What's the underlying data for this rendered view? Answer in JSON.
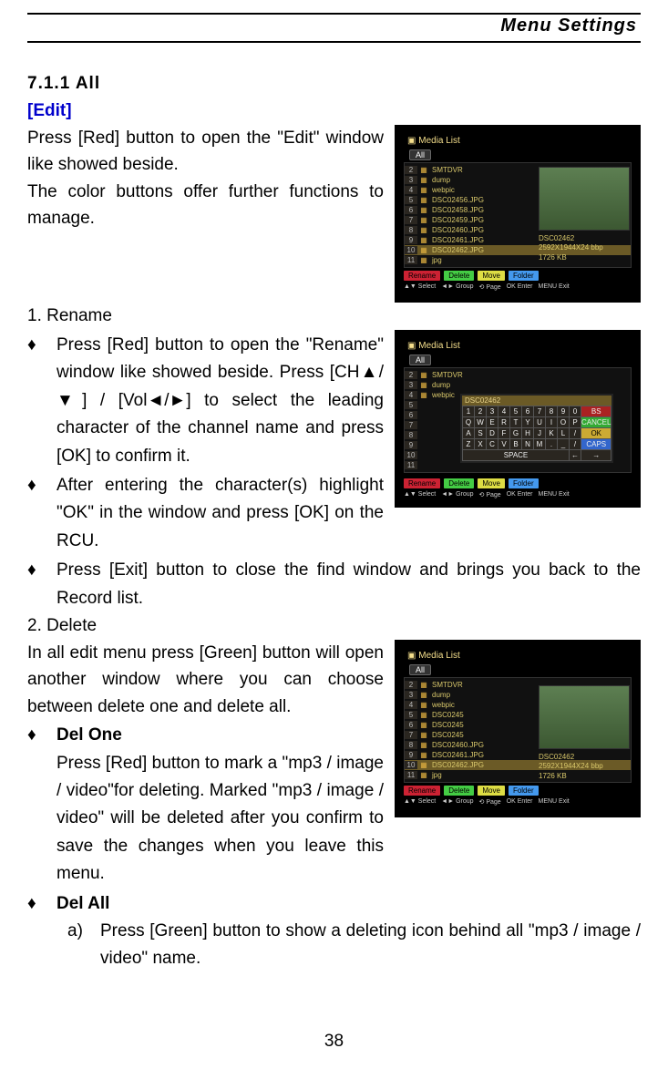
{
  "header": {
    "section": "Menu Settings"
  },
  "title": "7.1.1  All",
  "edit_label": "[Edit]",
  "intro1": "Press [Red] button to open the \"Edit\" window like showed beside.",
  "intro2": "The color buttons offer further functions to manage.",
  "h_rename": "1.   Rename",
  "rename_b1": "Press [Red] button to open the \"Rename\" window like showed beside. Press [CH▲/▼] / [Vol◄/►] to select the leading character of the channel name and press [OK] to confirm it.",
  "rename_b2": "After entering the character(s) highlight \"OK\" in the window and press [OK] on the RCU.",
  "rename_b3": "Press [Exit] button to close the find window and brings you back to the Record list.",
  "h_delete": "2.   Delete",
  "delete_intro": "In all edit menu press [Green] button will open another window where you can choose between delete one and delete all.",
  "delone_h": "Del One",
  "delone_p": "Press [Red] button to mark a \"mp3 / image / video\"for deleting. Marked \"mp3 / image / video\" will be deleted after you confirm to save the changes when you leave this menu.",
  "delall_h": "Del All",
  "delall_a": "Press [Green] button to show a deleting icon behind all \"mp3 / image / video\" name.",
  "page": "38",
  "scr": {
    "title": "Media List",
    "tab_all": "All",
    "files": [
      "SMTDVR",
      "dump",
      "webpic",
      "DSC02456.JPG",
      "DSC02458.JPG",
      "DSC02459.JPG",
      "DSC02460.JPG",
      "DSC02461.JPG",
      "DSC02462.JPG",
      "jpg"
    ],
    "meta_name": "DSC02462",
    "meta_res": "2592X1944X24 bbp",
    "meta_size": "1726 KB",
    "btns": {
      "rename": "Rename",
      "delete": "Delete",
      "move": "Move",
      "folder": "Folder"
    },
    "help": [
      "▲▼ Select",
      "◄► Group",
      "⟲ Page",
      "OK Enter",
      "MENU Exit"
    ],
    "osk_filename": "DSC02462",
    "delone": "Del One",
    "delall": "Del All"
  }
}
